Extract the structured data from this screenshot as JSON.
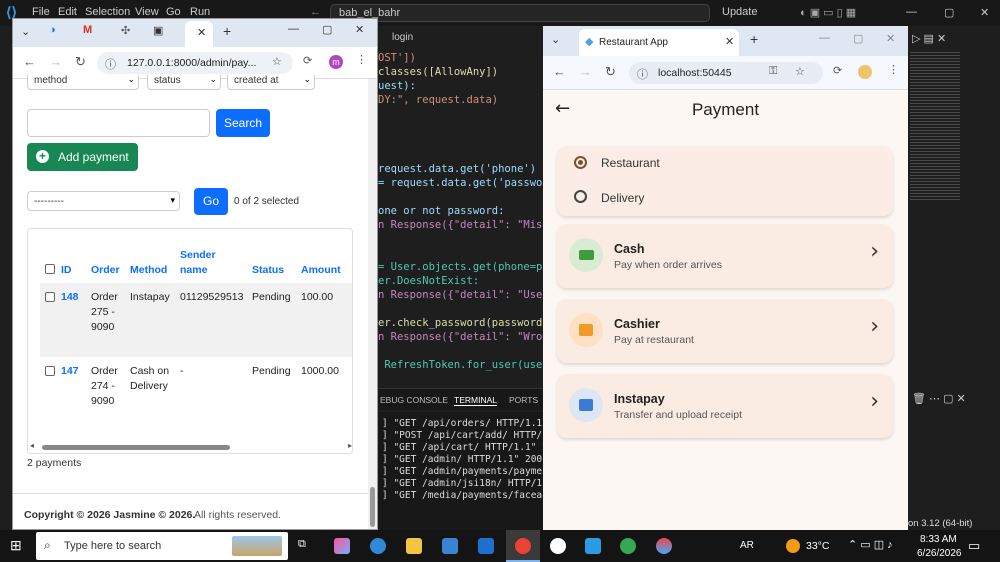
{
  "vscode": {
    "menu": [
      "File",
      "Edit",
      "Selection",
      "View",
      "Go",
      "Run"
    ],
    "search": "bab_el_bahr",
    "update": "Update",
    "tab_label": "login",
    "code_lines": [
      {
        "t": "OST'])"
      },
      {
        "t": "classes([AllowAny])"
      },
      {
        "t": "uest):"
      },
      {
        "t": "DY:\", request.data)"
      },
      {
        "t": "request.data.get('phone')"
      },
      {
        "t": "= request.data.get('password'"
      },
      {
        "t": "one or not password:"
      },
      {
        "t": "n Response({\"detail\": \"Missin"
      },
      {
        "t": "= User.objects.get(phone=phon"
      },
      {
        "t": "er.DoesNotExist:"
      },
      {
        "t": "n Response({\"detail\": \"User n"
      },
      {
        "t": "er.check_password(password):"
      },
      {
        "t": "n Response({\"detail\": \"Wrong"
      },
      {
        "t": " RefreshToken.for_user(user)"
      }
    ],
    "panel_tabs": [
      "EBUG CONSOLE",
      "TERMINAL",
      "PORTS"
    ],
    "terminal_lines": [
      "] \"GET /api/orders/ HTTP/1.1\" 20",
      "] \"POST /api/cart/add/ HTTP/1.1\"",
      "] \"GET /api/cart/ HTTP/1.1\" 200",
      "] \"GET /admin/ HTTP/1.1\" 200 357",
      "] \"GET /admin/payments/payment/",
      "] \"GET /admin/jsi18n/ HTTP/1.1\"",
      "] \"GET /media/payments/faceai.pn"
    ],
    "status_python": "on 3.12 (64-bit)"
  },
  "browser1": {
    "url": "127.0.0.1:8000/admin/pay...",
    "profile": "m",
    "filters": [
      "method",
      "status",
      "created at"
    ],
    "search_button": "Search",
    "add_button": "Add payment",
    "action_select": "---------",
    "go_button": "Go",
    "selected_text": "0 of 2 selected",
    "columns": [
      "ID",
      "Order",
      "Method",
      "Sender name",
      "Status",
      "Amount"
    ],
    "rows": [
      {
        "id": "148",
        "order": "Order 275 - 9090",
        "method": "Instapay",
        "sender": "01129529513",
        "status": "Pending",
        "amount": "100.00"
      },
      {
        "id": "147",
        "order": "Order 274 - 9090",
        "method": "Cash on Delivery",
        "sender": "-",
        "status": "Pending",
        "amount": "1000.00"
      }
    ],
    "count": "2 payments",
    "footer_bold": "Copyright © 2026 Jasmine © 2026.",
    "footer_rest": " All rights reserved."
  },
  "browser2": {
    "tab_title": "Restaurant App",
    "url": "localhost:50445",
    "page_title": "Payment",
    "options": [
      "Restaurant",
      "Delivery"
    ],
    "selected_option": "Restaurant",
    "methods": [
      {
        "title": "Cash",
        "subtitle": "Pay when order arrives",
        "color": "#d9ebd3",
        "icon": "cash-icon"
      },
      {
        "title": "Cashier",
        "subtitle": "Pay at restaurant",
        "color": "#fde1c2",
        "icon": "store-icon"
      },
      {
        "title": "Instapay",
        "subtitle": "Transfer and upload receipt",
        "color": "#dde6f3",
        "icon": "wallet-icon"
      }
    ]
  },
  "taskbar": {
    "search_placeholder": "Type here to search",
    "lang": "AR",
    "temp": "33°C",
    "time": "8:33 AM",
    "date": "6/26/2026"
  }
}
